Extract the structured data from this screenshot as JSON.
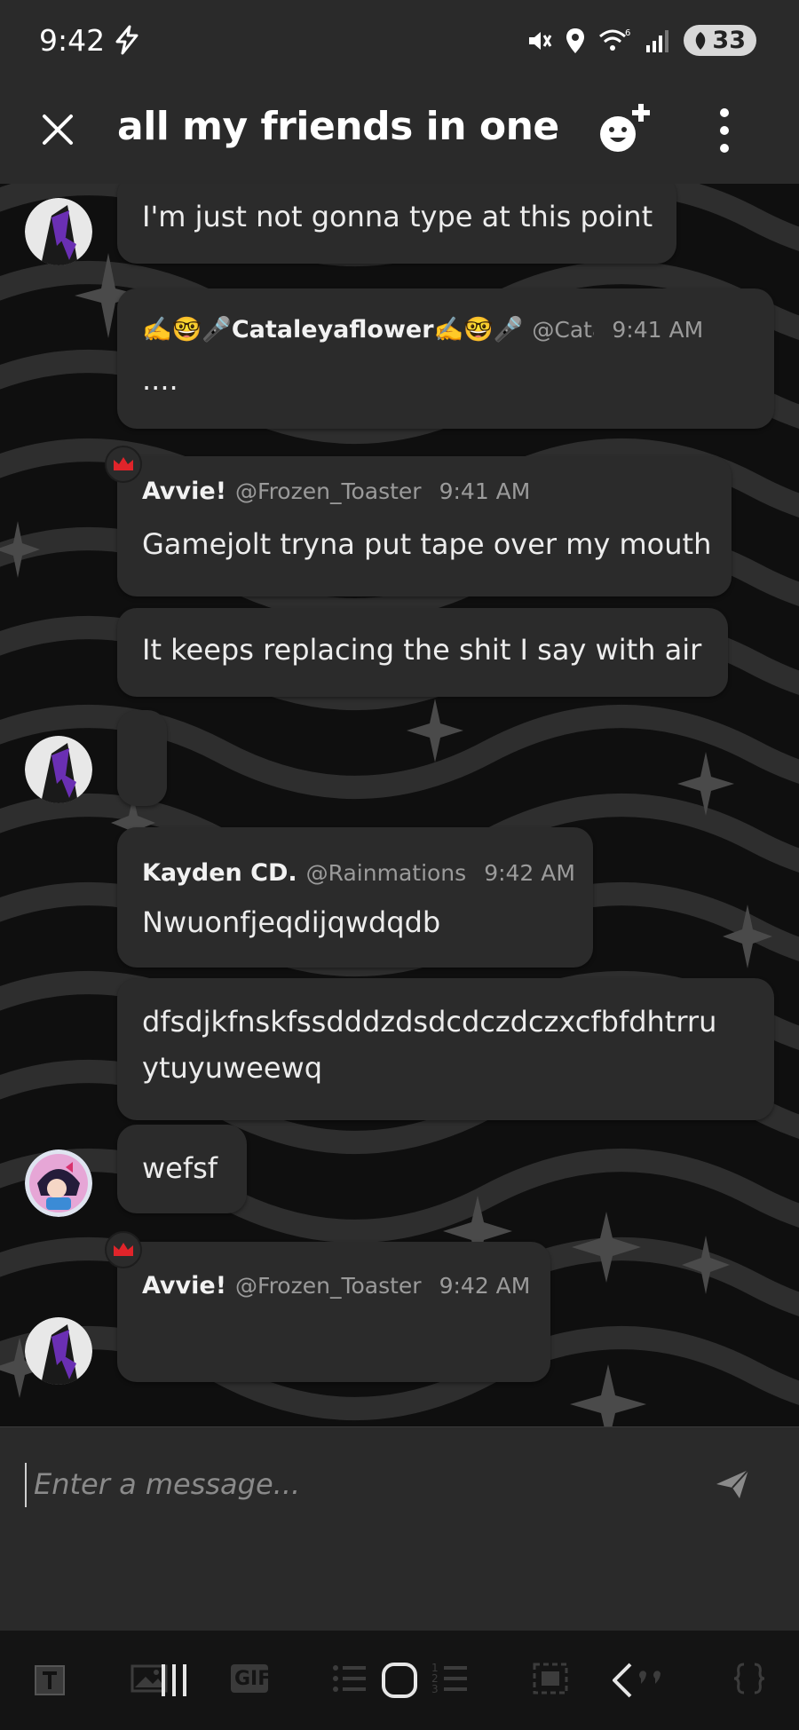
{
  "status_bar": {
    "time": "9:42",
    "battery": "33"
  },
  "header": {
    "title": "all my friends in one"
  },
  "messages": [
    {
      "text": "I'm just not gonna type at this point"
    },
    {
      "author": "✍️🤓🎤Cataleyaflower✍️🤓🎤",
      "handle": "@Catal",
      "time": "9:41 AM",
      "text": "...."
    },
    {
      "author": "Avvie!",
      "handle": "@Frozen_Toaster",
      "time": "9:41 AM",
      "text": "Gamejolt tryna put tape over my mouth"
    },
    {
      "text": "It keeps replacing the shit I say with air"
    },
    {
      "text": ""
    },
    {
      "author": "Kayden CD.",
      "handle": "@Rainmations",
      "time": "9:42 AM",
      "text": "Nwuonfjeqdijqwdqdb"
    },
    {
      "text_line1": "dfsdjkfnskfssdddzdsdcdczdczxcfbfdhtrru",
      "text_line2": "ytuyuweewq"
    },
    {
      "text": "wefsf"
    },
    {
      "author": "Avvie!",
      "handle": "@Frozen_Toaster",
      "time": "9:42 AM",
      "text": ""
    }
  ],
  "composer": {
    "placeholder": "Enter a message..."
  },
  "toolbar": {
    "gif_label": "GIF",
    "icons": [
      "text-format-icon",
      "image-icon",
      "gif-icon",
      "bullet-list-icon",
      "numbered-list-icon",
      "spoiler-icon",
      "quote-icon",
      "code-icon"
    ]
  },
  "colors": {
    "bar_bg": "#2a2a2a",
    "bubble_bg": "#2b2b2b",
    "crown": "#e0242a",
    "avatar_purple": "#6a2fb3"
  }
}
